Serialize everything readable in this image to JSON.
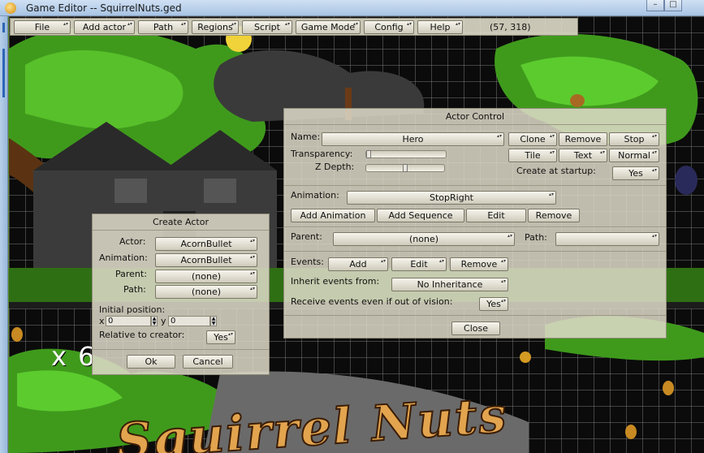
{
  "window": {
    "title": "Game Editor -- SquirrelNuts.ged",
    "minimize": "–",
    "maximize": "□"
  },
  "menu": {
    "items": [
      "File",
      "Add actor",
      "Path",
      "Regions",
      "Script",
      "Game Mode",
      "Config",
      "Help"
    ],
    "coords": "(57, 318)"
  },
  "scene": {
    "lives_text": "x 6",
    "logo_text": "Squirrel Nuts"
  },
  "actor_control": {
    "title": "Actor Control",
    "name_label": "Name:",
    "name_value": "Hero",
    "transparency_label": "Transparency:",
    "transparency_value": 0.0,
    "zdepth_label": "Z Depth:",
    "zdepth_value": 0.5,
    "clone": "Clone",
    "remove": "Remove",
    "stop": "Stop",
    "tile": "Tile",
    "text": "Text",
    "normal": "Normal",
    "create_startup_label": "Create at startup:",
    "create_startup_value": "Yes",
    "animation_label": "Animation:",
    "animation_value": "StopRight",
    "add_animation": "Add Animation",
    "add_sequence": "Add Sequence",
    "edit": "Edit",
    "remove_anim": "Remove",
    "parent_label": "Parent:",
    "parent_value": "(none)",
    "path_label": "Path:",
    "path_value": "",
    "events_label": "Events:",
    "events_add": "Add",
    "events_edit": "Edit",
    "events_remove": "Remove",
    "inherit_label": "Inherit events from:",
    "inherit_value": "No Inheritance",
    "receive_label": "Receive events even if out of vision:",
    "receive_value": "Yes",
    "close": "Close"
  },
  "create_actor": {
    "title": "Create Actor",
    "actor_label": "Actor:",
    "actor_value": "AcornBullet",
    "animation_label": "Animation:",
    "animation_value": "AcornBullet",
    "parent_label": "Parent:",
    "parent_value": "(none)",
    "path_label": "Path:",
    "path_value": "(none)",
    "initial_position_label": "Initial position:",
    "x_label": "x",
    "x_value": "0",
    "y_label": "y",
    "y_value": "0",
    "relative_label": "Relative to creator:",
    "relative_value": "Yes",
    "ok": "Ok",
    "cancel": "Cancel"
  },
  "colors": {
    "panel_bg": "#dedac8",
    "title_bar": "#b8cfea",
    "foliage": "#3f9a1c"
  },
  "icons": [
    "app-icon",
    "minimize-icon",
    "maximize-icon",
    "dropdown-arrows-icon",
    "spin-arrows-icon"
  ]
}
